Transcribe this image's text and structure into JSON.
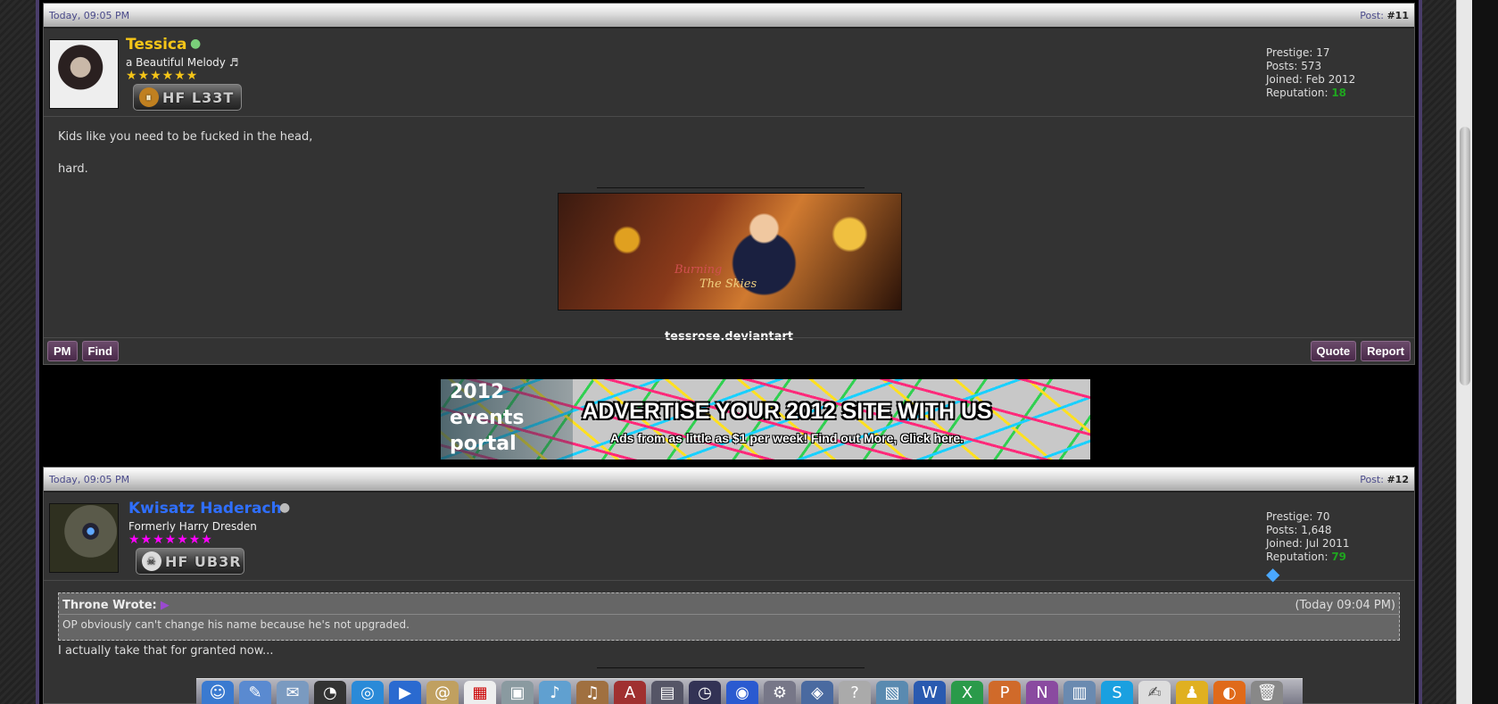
{
  "post11": {
    "date": "Today, 09:05 PM",
    "post_label": "Post:",
    "post_number": "#11",
    "username": "Tessica",
    "username_color": "#f5c518",
    "usertitle": "a Beautiful Melody ♬",
    "stars": "★★★★★★",
    "stars_color": "#f5c518",
    "badge": "HF L33T",
    "stats": {
      "prestige": "Prestige: 17",
      "posts": "Posts: 573",
      "joined": "Joined: Feb 2012",
      "reputation_label": "Reputation:",
      "reputation_value": "18"
    },
    "message_line1": "Kids like you need to be fucked in the head,",
    "message_line2": "hard.",
    "sig_banner_text1": "Burning",
    "sig_banner_text2": "The Skies",
    "sig_caption": "tessrose.deviantart",
    "buttons_left": [
      "PM",
      "Find"
    ],
    "buttons_right": [
      "Quote",
      "Report"
    ]
  },
  "ad": {
    "left_lines": [
      "2012",
      "events",
      "portal"
    ],
    "title": "ADVERTISE YOUR 2012 SITE WITH US",
    "subtitle": "Ads from as little as $1 per week! Find out More, Click here."
  },
  "post12": {
    "date": "Today, 09:05 PM",
    "post_label": "Post:",
    "post_number": "#12",
    "username": "Kwisatz Haderach",
    "username_color": "#2f6fff",
    "usertitle": "Formerly Harry Dresden",
    "stars": "★★★★★★★",
    "stars_color": "#ff00ff",
    "badge": "HF UB3R",
    "stats": {
      "prestige": "Prestige: 70",
      "posts": "Posts: 1,648",
      "joined": "Joined: Jul 2011",
      "reputation_label": "Reputation:",
      "reputation_value": "79"
    },
    "quote_author": "Throne Wrote:",
    "quote_time": "(Today 09:04 PM)",
    "quote_text": "OP obviously can't change his name because he's not upgraded.",
    "message": "I actually take that for granted now..."
  }
}
